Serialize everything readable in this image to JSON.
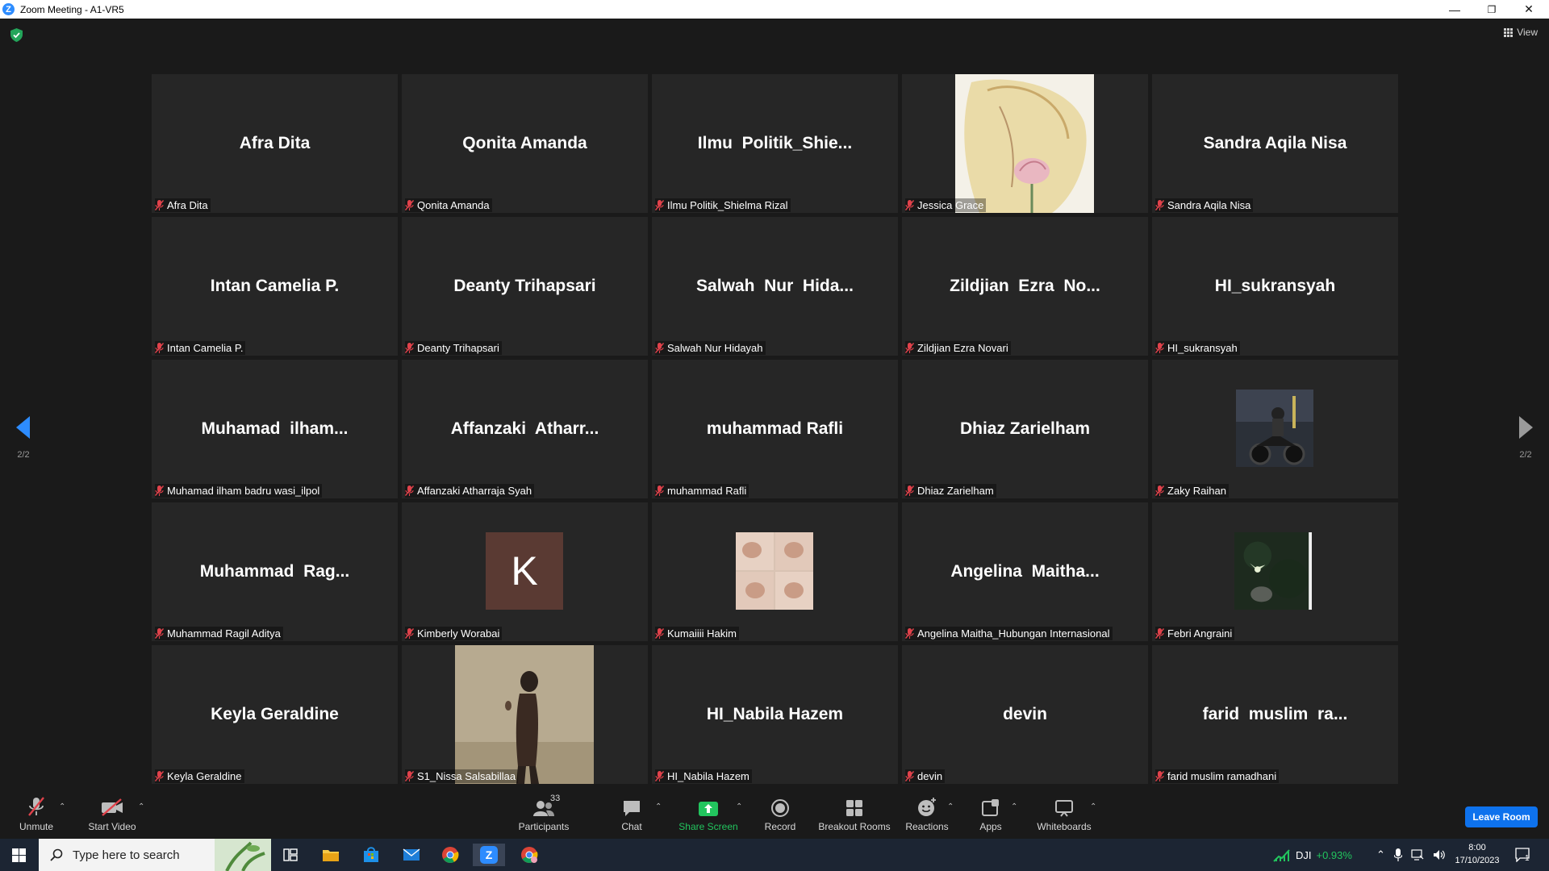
{
  "window": {
    "title": "Zoom Meeting - A1-VR5",
    "logo_letter": "Z",
    "minimize": "—",
    "restore": "❐",
    "close": "✕"
  },
  "meeting": {
    "view_label": "View",
    "page_left": "2/2",
    "page_right": "2/2",
    "tiles": [
      {
        "display": "Afra Dita",
        "label": "Afra Dita",
        "kind": "name"
      },
      {
        "display": "Qonita Amanda",
        "label": "Qonita Amanda",
        "kind": "name"
      },
      {
        "display": "Ilmu  Politik_Shie...",
        "label": "Ilmu Politik_Shielma Rizal",
        "kind": "name"
      },
      {
        "display": "",
        "label": "Jessica Grace",
        "kind": "sketch"
      },
      {
        "display": "Sandra Aqila Nisa",
        "label": "Sandra Aqila Nisa",
        "kind": "name"
      },
      {
        "display": "Intan Camelia P.",
        "label": "Intan Camelia P.",
        "kind": "name"
      },
      {
        "display": "Deanty Trihapsari",
        "label": "Deanty Trihapsari",
        "kind": "name"
      },
      {
        "display": "Salwah  Nur  Hida...",
        "label": "Salwah Nur Hidayah",
        "kind": "name"
      },
      {
        "display": "Zildjian  Ezra  No...",
        "label": "Zildjian Ezra Novari",
        "kind": "name"
      },
      {
        "display": "HI_sukransyah",
        "label": "HI_sukransyah",
        "kind": "name"
      },
      {
        "display": "Muhamad  ilham...",
        "label": "Muhamad ilham badru wasi_ilpol",
        "kind": "name"
      },
      {
        "display": "Affanzaki  Atharr...",
        "label": "Affanzaki Atharraja Syah",
        "kind": "name"
      },
      {
        "display": "muhammad Rafli",
        "label": "muhammad Rafli",
        "kind": "name"
      },
      {
        "display": "Dhiaz Zarielham",
        "label": "Dhiaz Zarielham",
        "kind": "name"
      },
      {
        "display": "",
        "label": "Zaky Raihan",
        "kind": "moto"
      },
      {
        "display": "Muhammad  Rag...",
        "label": "Muhammad Ragil Aditya",
        "kind": "name"
      },
      {
        "display": "K",
        "label": "Kimberly Worabai",
        "kind": "avatar"
      },
      {
        "display": "",
        "label": "Kumaiiii Hakim",
        "kind": "collage"
      },
      {
        "display": "Angelina  Maitha...",
        "label": "Angelina Maitha_Hubungan Internasional",
        "kind": "name"
      },
      {
        "display": "",
        "label": "Febri Angraini",
        "kind": "dark"
      },
      {
        "display": "Keyla Geraldine",
        "label": "Keyla Geraldine",
        "kind": "name"
      },
      {
        "display": "",
        "label": "S1_Nissa Salsabillaa",
        "kind": "portrait"
      },
      {
        "display": "HI_Nabila Hazem",
        "label": "HI_Nabila Hazem",
        "kind": "name"
      },
      {
        "display": "devin",
        "label": "devin",
        "kind": "name"
      },
      {
        "display": "farid  muslim  ra...",
        "label": "farid muslim ramadhani",
        "kind": "name"
      }
    ]
  },
  "toolbar": {
    "unmute": "Unmute",
    "start_video": "Start Video",
    "participants": "Participants",
    "participants_count": "33",
    "chat": "Chat",
    "share_screen": "Share Screen",
    "record": "Record",
    "breakout_rooms": "Breakout Rooms",
    "reactions": "Reactions",
    "apps": "Apps",
    "whiteboards": "Whiteboards",
    "leave_room": "Leave Room"
  },
  "taskbar": {
    "search_placeholder": "Type here to search",
    "stock_name": "DJI",
    "stock_change": "+0.93%",
    "time": "8:00",
    "date": "17/10/2023",
    "notification_count": "1"
  },
  "colors": {
    "accent_blue": "#0e72ed",
    "share_green": "#22c55e",
    "mute_red": "#e0424b"
  }
}
